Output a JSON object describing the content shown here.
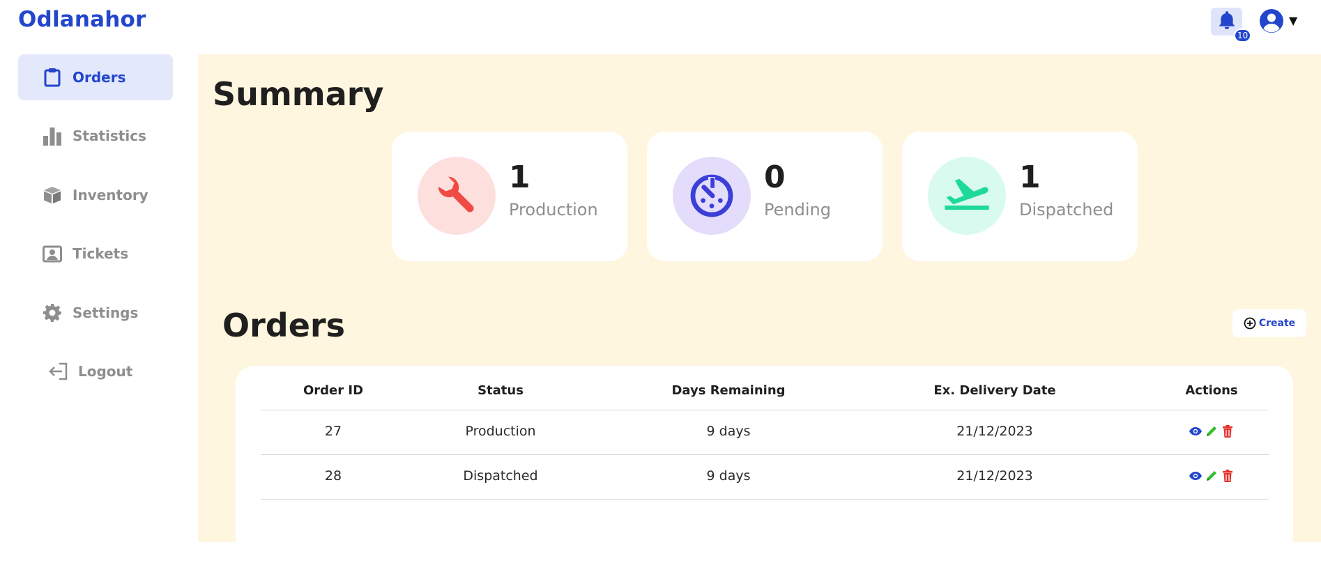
{
  "app": {
    "brand": "Odlanahor"
  },
  "header": {
    "notification_count": "10"
  },
  "sidebar": {
    "items": [
      {
        "label": "Orders",
        "icon": "clipboard-icon",
        "active": true
      },
      {
        "label": "Statistics",
        "icon": "bar-chart-icon",
        "active": false
      },
      {
        "label": "Inventory",
        "icon": "box-icon",
        "active": false
      },
      {
        "label": "Tickets",
        "icon": "ticket-icon",
        "active": false
      },
      {
        "label": "Settings",
        "icon": "gear-icon",
        "active": false
      },
      {
        "label": "Logout",
        "icon": "logout-icon",
        "active": false
      }
    ]
  },
  "summary": {
    "title": "Summary",
    "cards": [
      {
        "value": "1",
        "label": "Production",
        "icon": "wrench-icon",
        "icon_color": "#f04a44",
        "bg_color": "#fde0de"
      },
      {
        "value": "0",
        "label": "Pending",
        "icon": "timer-icon",
        "icon_color": "#3b3fd8",
        "bg_color": "#e3ddfb"
      },
      {
        "value": "1",
        "label": "Dispatched",
        "icon": "plane-takeoff-icon",
        "icon_color": "#1ed99a",
        "bg_color": "#d9fbef"
      }
    ]
  },
  "orders": {
    "title": "Orders",
    "create_label": "Create",
    "columns": [
      "Order ID",
      "Status",
      "Days Remaining",
      "Ex. Delivery Date",
      "Actions"
    ],
    "rows": [
      {
        "id": "27",
        "status": "Production",
        "days": "9 days",
        "date": "21/12/2023"
      },
      {
        "id": "28",
        "status": "Dispatched",
        "days": "9 days",
        "date": "21/12/2023"
      }
    ]
  },
  "colors": {
    "accent": "#2346cc",
    "main_bg": "#fef6de",
    "view_icon": "#2346cc",
    "edit_icon": "#2fbf2a",
    "delete_icon": "#e5322b"
  }
}
